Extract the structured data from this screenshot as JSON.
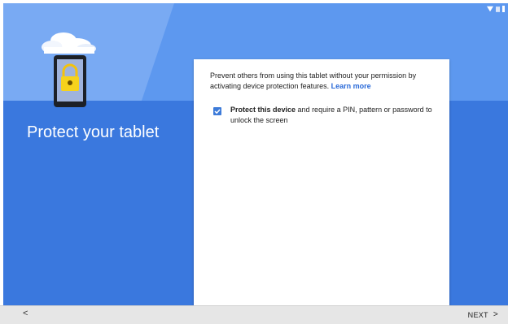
{
  "colors": {
    "background_dark": "#3a78de",
    "background_light": "#5d98ef",
    "card": "#ffffff",
    "accent": "#3d7bd9",
    "link": "#2a6ad8",
    "bottom_bar": "#e6e6e6"
  },
  "status_bar": {
    "icons": [
      "wifi-icon",
      "signal-icon",
      "battery-icon"
    ]
  },
  "illustration": {
    "icons": [
      "cloud-icon",
      "tablet-lock-icon"
    ]
  },
  "heading": "Protect your tablet",
  "card": {
    "description": "Prevent others from using this tablet without your permission by activating device protection features.",
    "learn_more": "Learn more",
    "option": {
      "checked": true,
      "label_bold": "Protect this device",
      "label_rest": "and require a PIN, pattern or password to unlock the screen"
    }
  },
  "bottom_bar": {
    "back_label": "<",
    "next_label": "NEXT",
    "next_chevron": ">"
  }
}
